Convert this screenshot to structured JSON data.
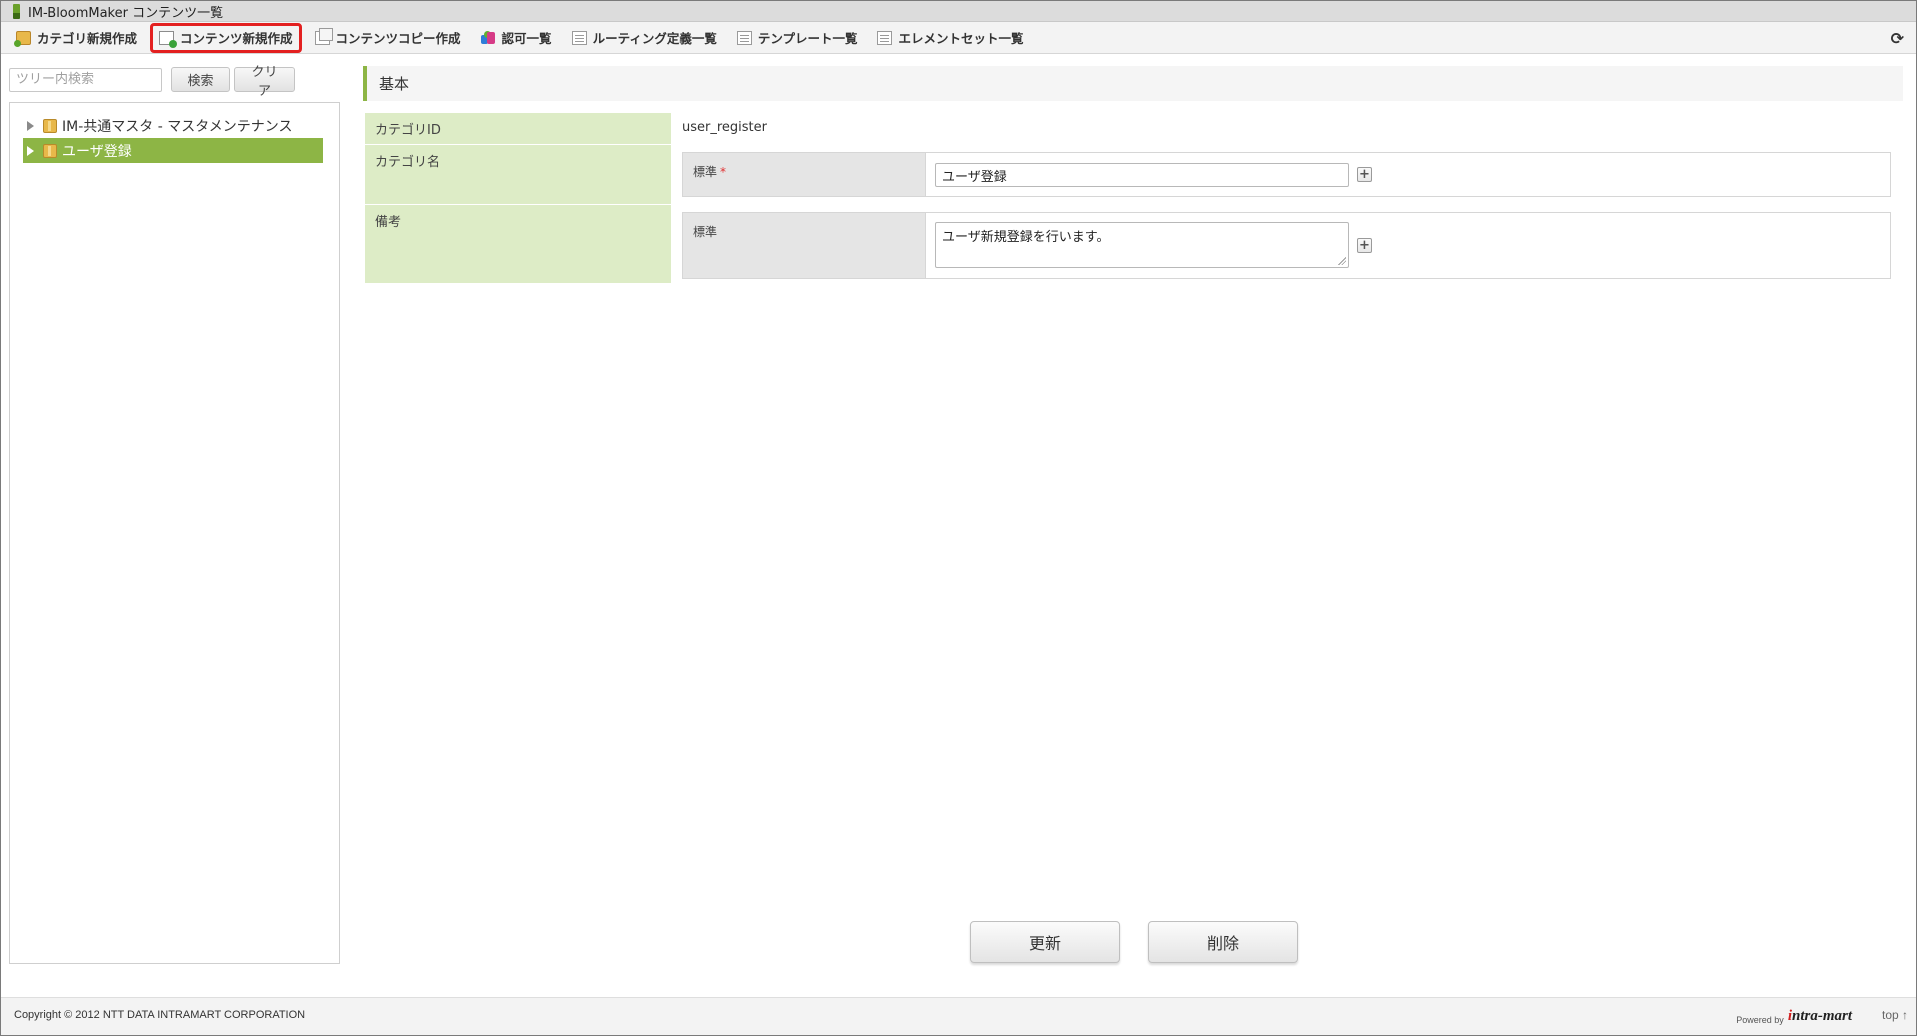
{
  "window": {
    "title": "IM-BloomMaker コンテンツ一覧"
  },
  "toolbar": {
    "items": [
      {
        "label": "カテゴリ新規作成",
        "icon": "folder-add-icon"
      },
      {
        "label": "コンテンツ新規作成",
        "icon": "content-add-icon",
        "highlighted": true
      },
      {
        "label": "コンテンツコピー作成",
        "icon": "copy-icon"
      },
      {
        "label": "認可一覧",
        "icon": "permission-icon"
      },
      {
        "label": "ルーティング定義一覧",
        "icon": "list-icon"
      },
      {
        "label": "テンプレート一覧",
        "icon": "list-icon"
      },
      {
        "label": "エレメントセット一覧",
        "icon": "list-icon"
      }
    ],
    "refresh_icon": "refresh-icon"
  },
  "tree": {
    "search_placeholder": "ツリー内検索",
    "search_button": "検索",
    "clear_button": "クリア",
    "nodes": [
      {
        "label": "IM-共通マスタ - マスタメンテナンス",
        "selected": false
      },
      {
        "label": "ユーザ登録",
        "selected": true
      }
    ]
  },
  "section": {
    "title": "基本"
  },
  "form": {
    "category_id": {
      "label": "カテゴリID",
      "value": "user_register"
    },
    "category_name": {
      "label": "カテゴリ名",
      "sub_label": "標準",
      "required_mark": "*",
      "value": "ユーザ登録"
    },
    "remarks": {
      "label": "備考",
      "sub_label": "標準",
      "value": "ユーザ新規登録を行います。"
    },
    "add_symbol": "+"
  },
  "actions": {
    "update": "更新",
    "delete": "削除"
  },
  "footer": {
    "copyright": "Copyright © 2012 NTT DATA INTRAMART CORPORATION",
    "powered_by": "Powered by",
    "logo_accent": "i",
    "logo_rest": "ntra-mart",
    "top_link": "top ↑"
  },
  "colors": {
    "accent_green": "#8db545",
    "label_bg": "#ddecc6",
    "highlight_red": "#e32020"
  }
}
